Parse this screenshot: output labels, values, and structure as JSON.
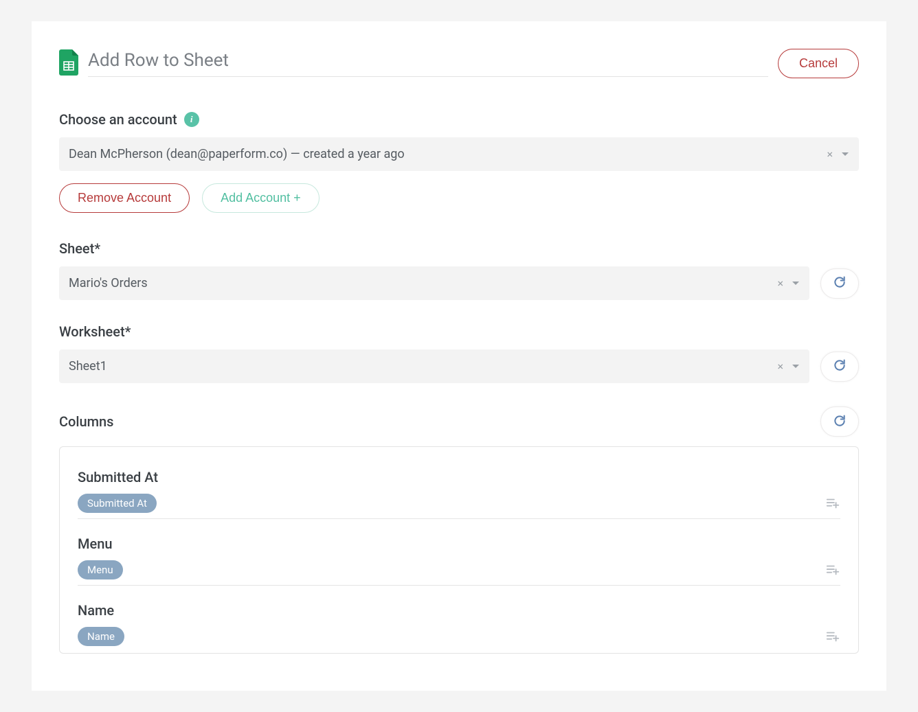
{
  "header": {
    "title": "Add Row to Sheet",
    "cancel_label": "Cancel"
  },
  "account": {
    "section_label": "Choose an account",
    "selected": "Dean McPherson (dean@paperform.co) — created a year ago",
    "remove_label": "Remove Account",
    "add_label": "Add Account +"
  },
  "sheet": {
    "section_label": "Sheet*",
    "selected": "Mario's Orders"
  },
  "worksheet": {
    "section_label": "Worksheet*",
    "selected": "Sheet1"
  },
  "columns": {
    "section_label": "Columns",
    "items": [
      {
        "label": "Submitted At",
        "chip": "Submitted At"
      },
      {
        "label": "Menu",
        "chip": "Menu"
      },
      {
        "label": "Name",
        "chip": "Name"
      }
    ]
  },
  "icons": {
    "info": "i"
  }
}
